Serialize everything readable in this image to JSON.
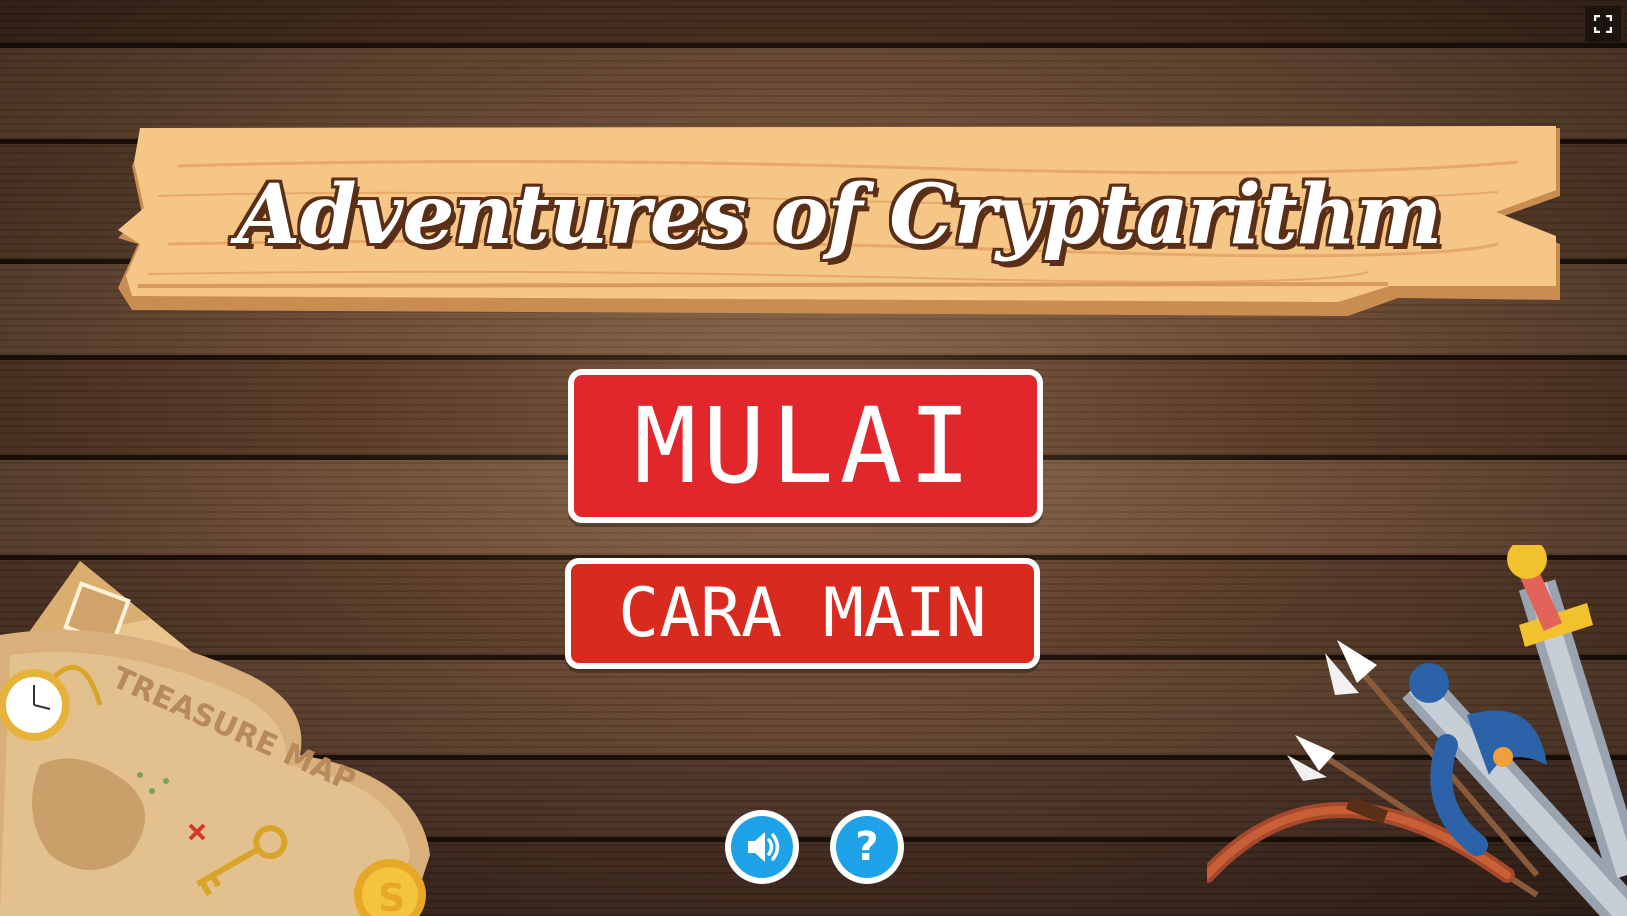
{
  "game": {
    "title": "Adventures of Cryptarithm"
  },
  "menu": {
    "start_label": "MULAI",
    "howto_label": "CARA MAIN"
  },
  "controls": {
    "sound_icon": "speaker-icon",
    "help_label": "?",
    "fullscreen_icon": "fullscreen-icon"
  },
  "decorations": {
    "map_label": "TREASURE MAP",
    "coin_symbol": "S"
  },
  "colors": {
    "button_red": "#e1262c",
    "button_border": "#ffffff",
    "round_button_blue": "#1fa3e8",
    "sign_wood": "#f6c687",
    "title_outline": "#5a2f17",
    "table_wood": "#5a3a25"
  }
}
